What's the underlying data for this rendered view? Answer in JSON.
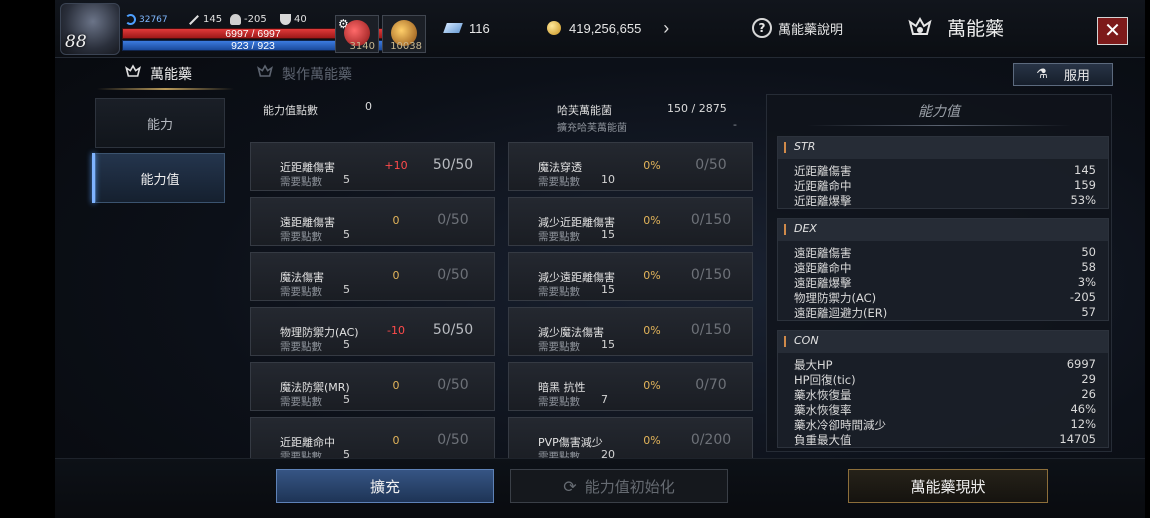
{
  "player": {
    "level": "88",
    "mp_badge": "32767",
    "attack": "145",
    "defense": "-205",
    "trophy": "40",
    "hp": "6997 / 6997",
    "mp": "923 / 923"
  },
  "slots": [
    {
      "count": "3140",
      "icon": "potion-icon",
      "color": "#c43030"
    },
    {
      "count": "10038",
      "icon": "pouch-icon",
      "color": "#d28a24"
    }
  ],
  "currency": {
    "gems": "116",
    "gold": "419,256,655"
  },
  "header": {
    "help_label": "萬能藥說明",
    "title": "萬能藥",
    "close_symbol": "✕"
  },
  "tabs": [
    {
      "label": "萬能藥",
      "active": true
    },
    {
      "label": "製作萬能藥",
      "active": false
    }
  ],
  "use_button": "服用",
  "nav": [
    {
      "label": "能力",
      "active": false
    },
    {
      "label": "能力值",
      "active": true
    }
  ],
  "summary": {
    "points_label": "能力值點數",
    "points_value": "0",
    "expand_label": "哈芙萬能菌",
    "expand_value": "150 / 2875",
    "expand_sub": "擴充哈芙萬能菌",
    "expand_sub_value": "-"
  },
  "req_label": "需要點數",
  "left_cards": [
    {
      "name": "近距離傷害",
      "req": "5",
      "bonus": "+10",
      "progress": "50/50"
    },
    {
      "name": "遠距離傷害",
      "req": "5",
      "bonus": "0",
      "progress": "0/50"
    },
    {
      "name": "魔法傷害",
      "req": "5",
      "bonus": "0",
      "progress": "0/50"
    },
    {
      "name": "物理防禦力(AC)",
      "req": "5",
      "bonus": "-10",
      "progress": "50/50"
    },
    {
      "name": "魔法防禦(MR)",
      "req": "5",
      "bonus": "0",
      "progress": "0/50"
    },
    {
      "name": "近距離命中",
      "req": "5",
      "bonus": "0",
      "progress": "0/50"
    }
  ],
  "right_cards": [
    {
      "name": "魔法穿透",
      "req": "10",
      "bonus": "0%",
      "progress": "0/50"
    },
    {
      "name": "減少近距離傷害",
      "req": "15",
      "bonus": "0%",
      "progress": "0/150"
    },
    {
      "name": "減少遠距離傷害",
      "req": "15",
      "bonus": "0%",
      "progress": "0/150"
    },
    {
      "name": "減少魔法傷害",
      "req": "15",
      "bonus": "0%",
      "progress": "0/150"
    },
    {
      "name": "暗黑 抗性",
      "req": "7",
      "bonus": "0%",
      "progress": "0/70"
    },
    {
      "name": "PVP傷害減少",
      "req": "20",
      "bonus": "0%",
      "progress": "0/200"
    }
  ],
  "stats_panel": {
    "title": "能力值",
    "sections": [
      {
        "name": "STR",
        "rows": [
          {
            "k": "近距離傷害",
            "v": "145"
          },
          {
            "k": "近距離命中",
            "v": "159"
          },
          {
            "k": "近距離爆擊",
            "v": "53%"
          }
        ]
      },
      {
        "name": "DEX",
        "rows": [
          {
            "k": "遠距離傷害",
            "v": "50"
          },
          {
            "k": "遠距離命中",
            "v": "58"
          },
          {
            "k": "遠距離爆擊",
            "v": "3%"
          },
          {
            "k": "物理防禦力(AC)",
            "v": "-205"
          },
          {
            "k": "遠距離迴避力(ER)",
            "v": "57"
          }
        ]
      },
      {
        "name": "CON",
        "rows": [
          {
            "k": "最大HP",
            "v": "6997"
          },
          {
            "k": "HP回復(tic)",
            "v": "29"
          },
          {
            "k": "藥水恢復量",
            "v": "26"
          },
          {
            "k": "藥水恢復率",
            "v": "46%"
          },
          {
            "k": "藥水冷卻時間減少",
            "v": "12%"
          },
          {
            "k": "負重最大值",
            "v": "14705"
          }
        ]
      }
    ]
  },
  "bottom": {
    "expand": "擴充",
    "reset": "能力值初始化",
    "status": "萬能藥現狀"
  }
}
